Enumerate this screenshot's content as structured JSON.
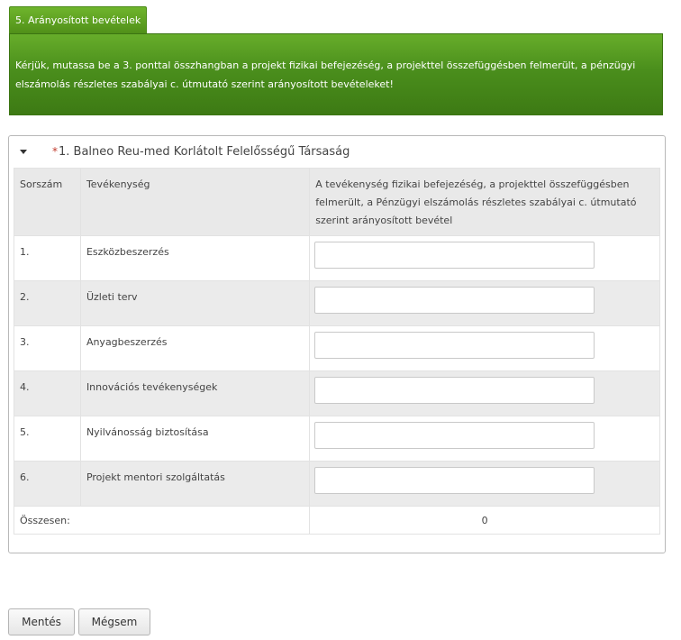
{
  "section_tab": "5. Arányosított bevételek",
  "instruction": "Kérjük, mutassa be a 3. ponttal összhangban a projekt fizikai befejezéség, a projekttel összefüggésben felmerült, a pénzügyi elszámolás részletes szabályai c. útmutató szerint arányosított bevételeket!",
  "panel": {
    "required_mark": "*",
    "title": "1. Balneo Reu-med Korlátolt Felelősségű Társaság"
  },
  "table": {
    "headers": {
      "col1": "Sorszám",
      "col2": "Tevékenység",
      "col3": "A tevékenység fizikai befejezéség, a projekttel összefüggésben felmerült, a Pénzügyi elszámolás részletes szabályai c. útmutató szerint arányosított bevétel"
    },
    "rows": [
      {
        "num": "1.",
        "activity": "Eszközbeszerzés",
        "value": ""
      },
      {
        "num": "2.",
        "activity": "Üzleti terv",
        "value": ""
      },
      {
        "num": "3.",
        "activity": "Anyagbeszerzés",
        "value": ""
      },
      {
        "num": "4.",
        "activity": "Innovációs tevékenységek",
        "value": ""
      },
      {
        "num": "5.",
        "activity": "Nyilvánosság biztosítása",
        "value": ""
      },
      {
        "num": "6.",
        "activity": "Projekt mentori szolgáltatás",
        "value": ""
      }
    ],
    "total_label": "Összesen:",
    "total_value": "0"
  },
  "buttons": {
    "save": "Mentés",
    "cancel": "Mégsem"
  }
}
